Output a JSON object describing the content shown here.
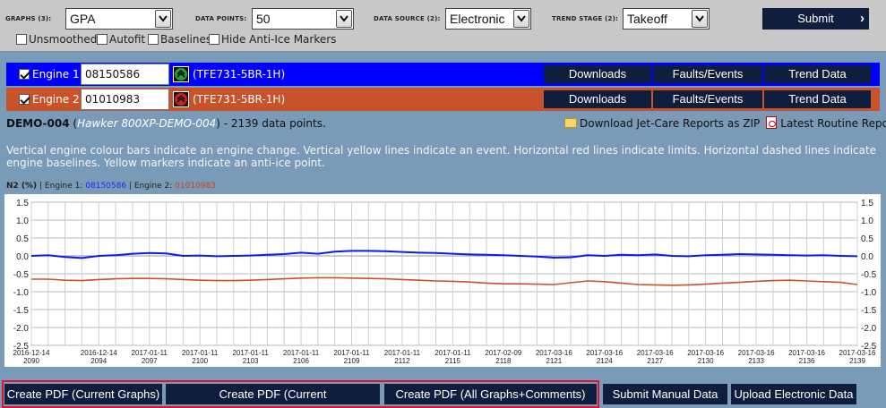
{
  "filters": {
    "graphs": {
      "label": "GRAPHS (3):",
      "value": "GPA"
    },
    "data_points": {
      "label": "DATA POINTS:",
      "value": "50"
    },
    "data_source": {
      "label": "DATA SOURCE (2):",
      "value": "Electronic"
    },
    "trend_stage": {
      "label": "TREND STAGE (2):",
      "value": "Takeoff"
    },
    "submit_label": "Submit",
    "options": [
      {
        "label": "Unsmoothed",
        "checked": false
      },
      {
        "label": "Autofit",
        "checked": false
      },
      {
        "label": "Baselines",
        "checked": false
      },
      {
        "label": "Hide Anti-Ice Markers",
        "checked": false
      }
    ]
  },
  "engines": [
    {
      "label": "Engine 1:",
      "serial": "08150586",
      "type": "(TFE731-5BR-1H)",
      "color": "#0000ff",
      "checked": true
    },
    {
      "label": "Engine 2:",
      "serial": "01010983",
      "type": "(TFE731-5BR-1H)",
      "color": "#c8522a",
      "checked": true
    }
  ],
  "engine_buttons": [
    "Downloads",
    "Faults/Events",
    "Trend Data"
  ],
  "aircraft": {
    "id": "DEMO-004",
    "open_paren": "(",
    "name": "Hawker 800XP-DEMO-004",
    "rest": ") - 2139 data points."
  },
  "reports": {
    "zip_link": "Download Jet-Care Reports as ZIP",
    "routine_link": "Latest Routine Report"
  },
  "legend_text": "Vertical engine colour bars indicate an engine change. Vertical yellow lines indicate an event. Horizontal red lines indicate limits. Horizontal dashed lines indicate engine baselines. Yellow markers indicate an anti-ice point.",
  "graph_title": {
    "param": "N2 (%)",
    "sep1": " | Engine 1: ",
    "e1": "08150586",
    "sep2": " | Engine 2: ",
    "e2": "01010983"
  },
  "chart_data": {
    "type": "line",
    "ylim": [
      -2.5,
      1.5
    ],
    "yticks": [
      "1.5",
      "1.0",
      "0.5",
      "0.0",
      "-0.5",
      "-1.0",
      "-1.5",
      "-2.0",
      "-2.5"
    ],
    "ytick_values": [
      1.5,
      1.0,
      0.5,
      0.0,
      -0.5,
      -1.0,
      -1.5,
      -2.0,
      -2.5
    ],
    "xticks": [
      {
        "date": "2016-12-14",
        "point": "2090"
      },
      {
        "date": "2016-12-14",
        "point": "2094"
      },
      {
        "date": "2017-01-11",
        "point": "2097"
      },
      {
        "date": "2017-01-11",
        "point": "2100"
      },
      {
        "date": "2017-01-11",
        "point": "2103"
      },
      {
        "date": "2017-01-11",
        "point": "2106"
      },
      {
        "date": "2017-01-11",
        "point": "2109"
      },
      {
        "date": "2017-01-11",
        "point": "2112"
      },
      {
        "date": "2017-01-11",
        "point": "2115"
      },
      {
        "date": "2017-02-09",
        "point": "2118"
      },
      {
        "date": "2017-03-16",
        "point": "2121"
      },
      {
        "date": "2017-03-16",
        "point": "2124"
      },
      {
        "date": "2017-03-16",
        "point": "2127"
      },
      {
        "date": "2017-03-16",
        "point": "2130"
      },
      {
        "date": "2017-03-16",
        "point": "2133"
      },
      {
        "date": "2017-03-16",
        "point": "2136"
      },
      {
        "date": "2017-03-16",
        "point": "2139"
      }
    ],
    "x_range": [
      2090,
      2139
    ],
    "series": [
      {
        "color": "#0a1aff",
        "values": [
          0.0,
          0.02,
          -0.03,
          -0.06,
          0.0,
          0.02,
          0.06,
          0.08,
          0.07,
          0.0,
          0.01,
          -0.01,
          0.0,
          0.01,
          0.03,
          0.05,
          0.09,
          0.06,
          0.12,
          0.14,
          0.14,
          0.13,
          0.11,
          0.09,
          0.08,
          0.06,
          0.04,
          0.03,
          0.02,
          0.0,
          -0.02,
          -0.05,
          -0.04,
          0.02,
          0.0,
          0.03,
          0.02,
          0.04,
          0.0,
          -0.01,
          0.02,
          0.03,
          0.05,
          0.04,
          0.03,
          0.02,
          0.01,
          0.02,
          0.0,
          -0.01
        ]
      },
      {
        "color": "#c8522a",
        "values": [
          -0.65,
          -0.65,
          -0.68,
          -0.69,
          -0.66,
          -0.64,
          -0.63,
          -0.63,
          -0.64,
          -0.66,
          -0.68,
          -0.69,
          -0.69,
          -0.68,
          -0.66,
          -0.64,
          -0.62,
          -0.61,
          -0.61,
          -0.62,
          -0.63,
          -0.64,
          -0.66,
          -0.68,
          -0.7,
          -0.71,
          -0.73,
          -0.76,
          -0.78,
          -0.78,
          -0.79,
          -0.8,
          -0.75,
          -0.7,
          -0.72,
          -0.76,
          -0.8,
          -0.81,
          -0.82,
          -0.81,
          -0.79,
          -0.76,
          -0.74,
          -0.71,
          -0.69,
          -0.68,
          -0.7,
          -0.72,
          -0.74,
          -0.8
        ]
      }
    ],
    "grid": true
  },
  "bottom_buttons": {
    "pdf_current": "Create PDF (Current Graphs)",
    "pdf_comments": "Create PDF (Current Graphs+Comments)",
    "pdf_all": "Create PDF (All Graphs+Comments)",
    "manual": "Submit Manual Data",
    "upload": "Upload Electronic Data"
  }
}
